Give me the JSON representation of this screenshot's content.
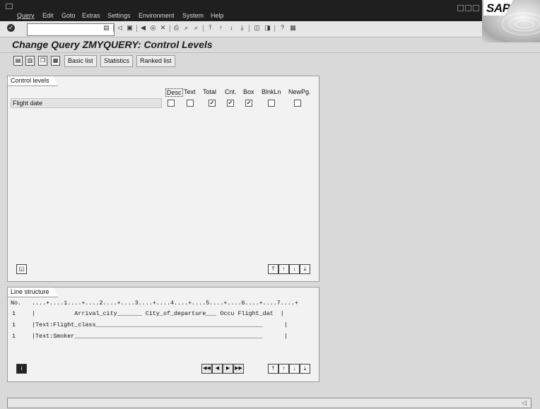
{
  "menubar": {
    "items": [
      "Query",
      "Edit",
      "Goto",
      "Extras",
      "Settings",
      "Environment",
      "System",
      "Help"
    ]
  },
  "system_toolbar": {
    "command_field_value": ""
  },
  "page": {
    "title": "Change Query ZMYQUERY: Control Levels"
  },
  "app_toolbar": {
    "buttons": [
      "Basic list",
      "Statistics",
      "Ranked list"
    ]
  },
  "control_levels": {
    "tab_title": "Control levels",
    "columns": [
      "Desc",
      "Text",
      "Total",
      "Cnt.",
      "Box",
      "BlnkLn",
      "NewPg."
    ],
    "rows": [
      {
        "label": "Flight date",
        "checks": [
          false,
          false,
          true,
          true,
          true,
          false,
          false
        ]
      }
    ]
  },
  "line_structure": {
    "tab_title": "Line structure",
    "header_no": "No.",
    "ruler": "....+....1....+....2....+....3....+....4....+....5....+....6....+....7....+",
    "lines": [
      {
        "no": "1",
        "text": "|           Arrival_city_______ City_of_departure___ Occu Flight_dat  |"
      },
      {
        "no": "1",
        "text": "|Text:Flight_class_______________________________________________      |"
      },
      {
        "no": "1",
        "text": "|Text:Smoker_____________________________________________________      |"
      }
    ]
  },
  "sap_logo": {
    "label": "SAP"
  },
  "colors": {
    "menubar": "#1f1f1f",
    "background": "#d9d9d9",
    "panel": "#f2f2f2"
  }
}
